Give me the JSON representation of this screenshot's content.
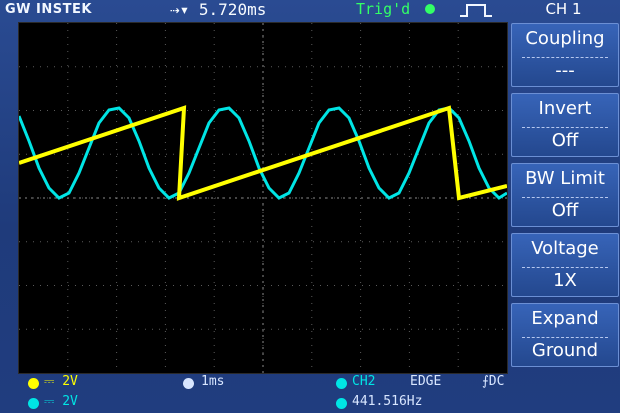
{
  "header": {
    "brand": "GW INSTEK",
    "time_position": "5.720ms",
    "trigger_status": "Trig'd"
  },
  "side_menu": {
    "title": "CH 1",
    "items": [
      {
        "label": "Coupling",
        "value": "---"
      },
      {
        "label": "Invert",
        "value": "Off"
      },
      {
        "label": "BW Limit",
        "value": "Off"
      },
      {
        "label": "Voltage",
        "value": "1X"
      },
      {
        "label": "Expand",
        "value": "Ground"
      }
    ]
  },
  "status": {
    "ch1_scale": "2V",
    "ch2_scale": "2V",
    "timebase": "1ms",
    "trigger_source": "CH2",
    "trigger_type": "EDGE",
    "trigger_coupling": "DC",
    "frequency": "441.516Hz"
  },
  "colors": {
    "ch1": "#ffff00",
    "ch2": "#00e5e5",
    "trigger": "#33ff66"
  }
}
